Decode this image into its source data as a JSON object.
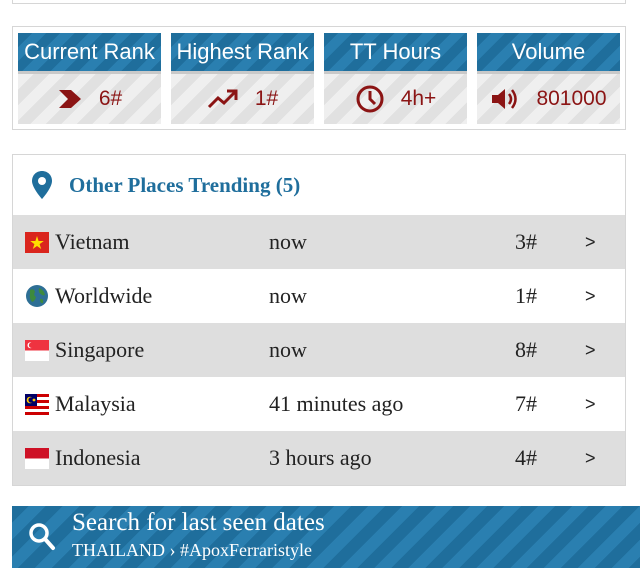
{
  "stats": [
    {
      "label": "Current Rank",
      "value": "6#",
      "icon": "chevron-right-icon"
    },
    {
      "label": "Highest Rank",
      "value": "1#",
      "icon": "trending-up-icon"
    },
    {
      "label": "TT Hours",
      "value": "4h+",
      "icon": "clock-icon"
    },
    {
      "label": "Volume",
      "value": "801000",
      "icon": "volume-icon"
    }
  ],
  "places": {
    "title": "Other Places Trending (5)",
    "rows": [
      {
        "name": "Vietnam",
        "time": "now",
        "rank": "3#",
        "arrow": ">",
        "flag": "vietnam-flag-icon"
      },
      {
        "name": "Worldwide",
        "time": "now",
        "rank": "1#",
        "arrow": ">",
        "flag": "globe-icon"
      },
      {
        "name": "Singapore",
        "time": "now",
        "rank": "8#",
        "arrow": ">",
        "flag": "singapore-flag-icon"
      },
      {
        "name": "Malaysia",
        "time": "41 minutes ago",
        "rank": "7#",
        "arrow": ">",
        "flag": "malaysia-flag-icon"
      },
      {
        "name": "Indonesia",
        "time": "3 hours ago",
        "rank": "4#",
        "arrow": ">",
        "flag": "indonesia-flag-icon"
      }
    ]
  },
  "search": {
    "title": "Search for last seen dates",
    "subtitle": "THAILAND › #ApoxFerraristyle",
    "icon": "search-icon"
  },
  "colors": {
    "accent": "#1f6e9c",
    "stat_value": "#8b1414",
    "row_shade": "#dedede"
  }
}
